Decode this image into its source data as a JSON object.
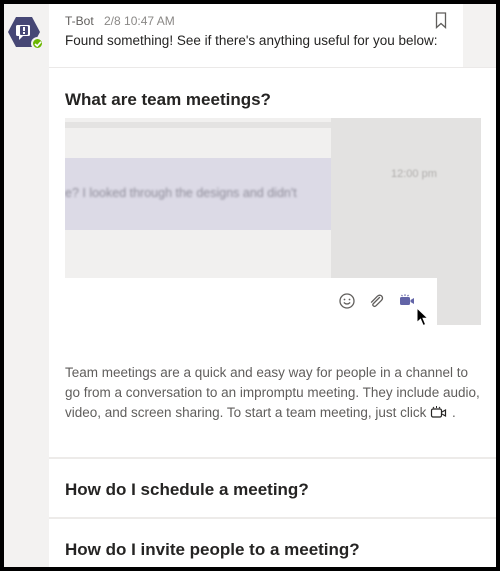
{
  "message": {
    "sender": "T-Bot",
    "timestamp": "2/8 10:47 AM",
    "text": "Found something! See if there's anything useful for you below:"
  },
  "card": {
    "sections": [
      {
        "title": "What are team meetings?",
        "preview": {
          "bubble_text": "e? I looked through the designs and didn't",
          "time": "12:00 pm"
        },
        "description": "Team meetings are a quick and easy way for people in a channel to go from a conversation to an impromptu meeting. They include audio, video, and screen sharing. To start a team meeting, just click",
        "description_end": "."
      },
      {
        "title": "How do I schedule a meeting?"
      },
      {
        "title": "How do I invite people to a meeting?"
      }
    ]
  },
  "icons": {
    "avatar": "bot-avatar-icon",
    "presence": "available-check-icon",
    "bookmark": "bookmark-icon",
    "emoji": "emoji-icon",
    "attach": "paperclip-icon",
    "meet_now": "video-camera-icon",
    "cursor": "mouse-pointer-icon"
  },
  "colors": {
    "accent": "#6264a7",
    "presence": "#6bb700",
    "avatar_bg": "#464775"
  }
}
